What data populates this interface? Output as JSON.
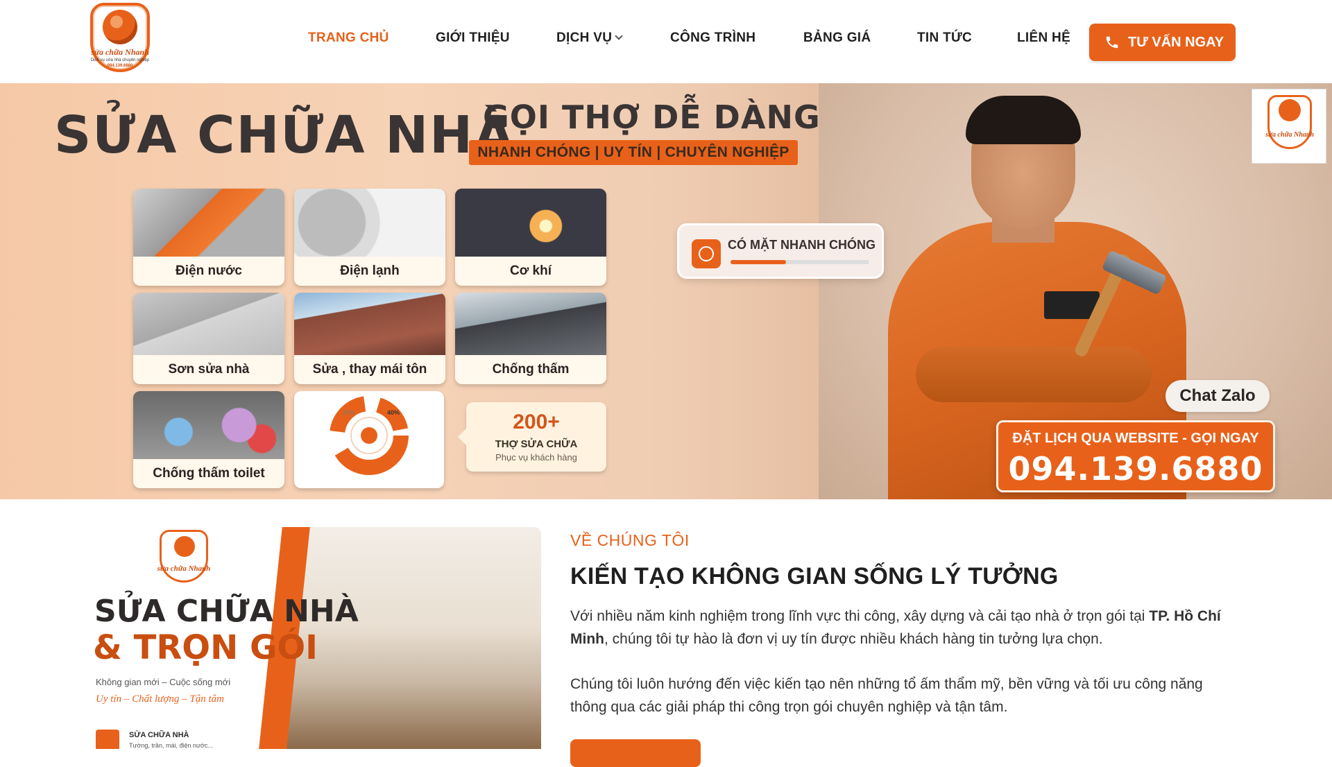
{
  "header": {
    "logo": {
      "line1": "sửa chữa Nhanh",
      "line2": "Dịch vụ sửa nhà chuyên nghiệp",
      "line3": "094.139.6880"
    },
    "nav": [
      {
        "label": "TRANG CHỦ",
        "active": true
      },
      {
        "label": "GIỚI THIỆU",
        "active": false
      },
      {
        "label": "DỊCH VỤ",
        "active": false,
        "dropdown": true
      },
      {
        "label": "CÔNG TRÌNH",
        "active": false
      },
      {
        "label": "BẢNG GIÁ",
        "active": false
      },
      {
        "label": "TIN TỨC",
        "active": false
      },
      {
        "label": "LIÊN HỆ",
        "active": false
      }
    ],
    "cta_label": "TƯ VẤN NGAY",
    "cta_icon": "phone-icon"
  },
  "hero": {
    "title": "SỬA CHỮA NHÀ",
    "subtitle": "GỌI THỢ DỄ DÀNG",
    "tagline": "NHANH CHÓNG | UY TÍN | CHUYÊN NGHIỆP",
    "services": [
      {
        "label": "Điện nước"
      },
      {
        "label": "Điện lạnh"
      },
      {
        "label": "Cơ khí"
      },
      {
        "label": "Sơn sửa nhà"
      },
      {
        "label": "Sửa , thay mái tôn"
      },
      {
        "label": "Chống thấm"
      },
      {
        "label": "Chống thấm toilet"
      }
    ],
    "pie_labels": [
      "35%",
      "40%"
    ],
    "stat": {
      "number": "200+",
      "line1": "THỢ SỬA CHỮA",
      "line2": "Phục vụ khách hàng"
    },
    "fast_card": {
      "label": "CÓ MẶT NHANH CHÓNG",
      "progress": 0.4
    },
    "mini_logo_text": "sửa chữa Nhanh",
    "chat_label": "Chat Zalo",
    "booking": {
      "line1": "ĐẶT LỊCH QUA WEBSITE - GỌI NGAY",
      "phone": "094.139.6880"
    }
  },
  "about": {
    "image": {
      "logo_text": "sửa chữa Nhanh",
      "headline1": "SỬA CHỮA NHÀ",
      "headline2": "& TRỌN GÓI",
      "slogan": "Không gian mới – Cuộc sống mới",
      "script": "Uy tín – Chất lượng – Tận tâm",
      "row_title": "SỬA CHỮA NHÀ",
      "row_sub": "Tường, trần, mái, điện nước..."
    },
    "label": "VỀ CHÚNG TÔI",
    "title": "KIẾN TẠO KHÔNG GIAN SỐNG LÝ TƯỞNG",
    "p1_before": "Với nhiều năm kinh nghiệm trong lĩnh vực thi công, xây dựng và cải tạo nhà ở trọn gói tại ",
    "p1_bold": "TP. Hồ Chí Minh",
    "p1_after": ", chúng tôi tự hào là đơn vị uy tín được nhiều khách hàng tin tưởng lựa chọn.",
    "p2": "Chúng tôi luôn hướng đến việc kiến tạo nên những tổ ấm thẩm mỹ, bền vững và tối ưu công năng thông qua các giải pháp thi công trọn gói chuyên nghiệp và tận tâm."
  },
  "colors": {
    "accent": "#e8611a",
    "text": "#1f1f1f"
  }
}
